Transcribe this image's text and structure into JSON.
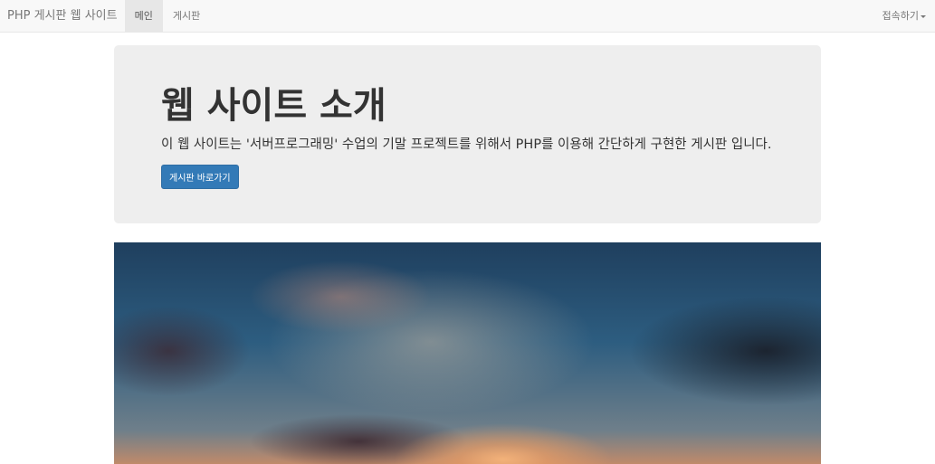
{
  "navbar": {
    "brand": "PHP 게시판 웹 사이트",
    "items": [
      {
        "label": "메인",
        "active": true
      },
      {
        "label": "게시판",
        "active": false
      }
    ],
    "right_menu": "접속하기"
  },
  "jumbotron": {
    "title": "웹 사이트 소개",
    "description": "이 웹 사이트는 '서버프로그래밍' 수업의 기말 프로젝트를 위해서 PHP를 이용해 간단하게 구현한 게시판 입니다.",
    "button": "게시판 바로가기"
  },
  "colors": {
    "button": "#337ab7",
    "jumbotron_bg": "#eeeeee"
  }
}
